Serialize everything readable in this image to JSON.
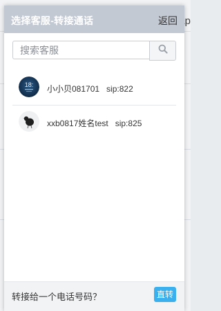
{
  "background": {
    "right_text": "Ap"
  },
  "dialog": {
    "title": "选择客服-转接通话",
    "back_label": "返回",
    "search": {
      "value": "",
      "placeholder": "搜索客服",
      "button_icon": "search-icon"
    },
    "agents": [
      {
        "name": "小小贝081701",
        "sip": "sip:822",
        "avatar_icon": "phone-lockscreen-avatar"
      },
      {
        "name": "xxb0817姓名test",
        "sip": "sip:825",
        "avatar_icon": "black-bird-avatar"
      }
    ],
    "footer": {
      "prompt": "转接给一个电话号码？",
      "button_label": "直转"
    }
  },
  "colors": {
    "header_bg": "#c3c9d3",
    "button_accent": "#3bb0ee",
    "footer_bg": "#f2f3f5"
  }
}
